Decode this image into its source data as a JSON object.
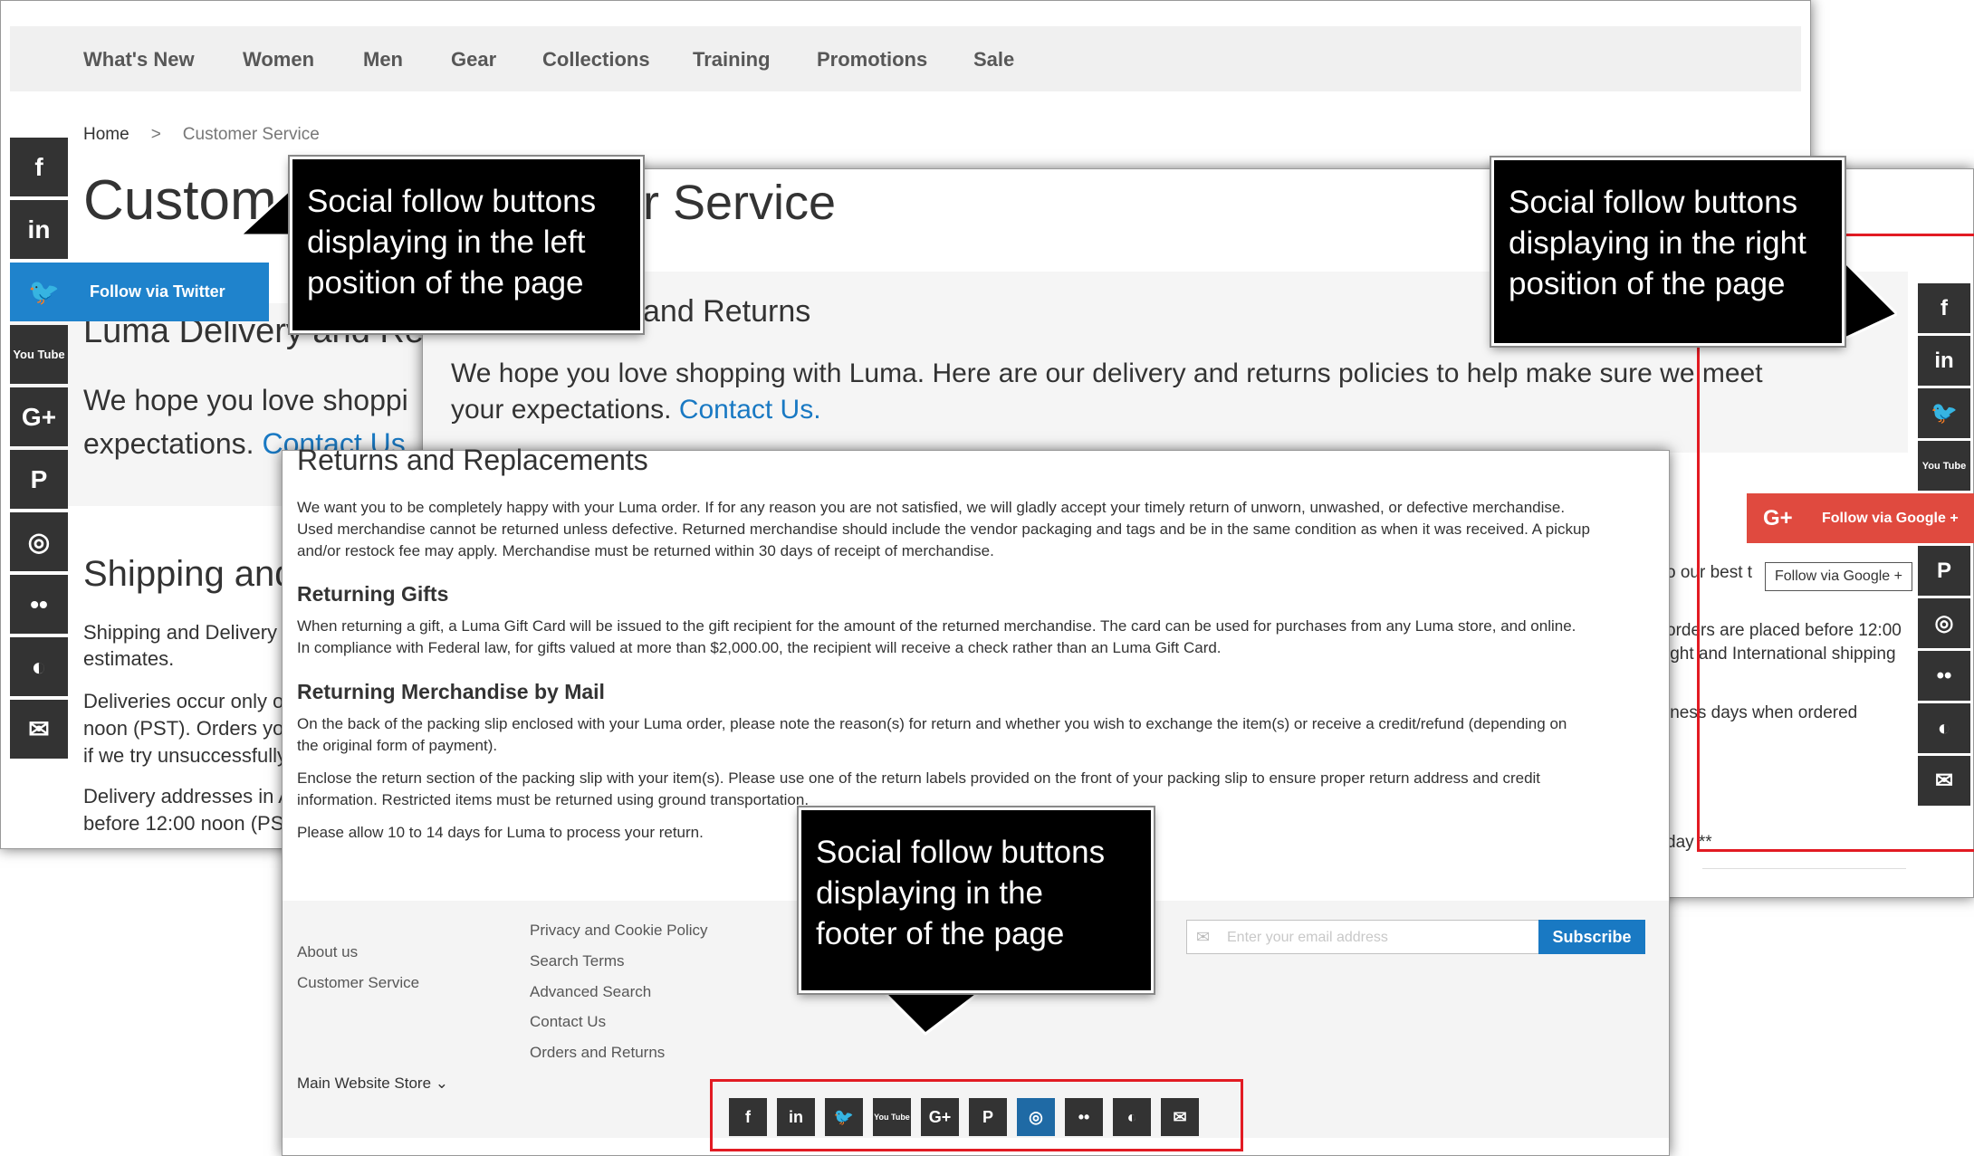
{
  "back_page": {
    "nav": [
      "What's New",
      "Women",
      "Men",
      "Gear",
      "Collections",
      "Training",
      "Promotions",
      "Sale"
    ],
    "breadcrumb": {
      "home": "Home",
      "separator": ">",
      "current": "Customer Service"
    },
    "title": "Custom",
    "section_heading": "Luma Delivery and Re",
    "intro_line1": "We hope you love shoppi",
    "intro_line2": "expectations.",
    "intro_link": "Contact Us",
    "shipping_heading": "Shipping and",
    "texts": [
      "Shipping and Delivery",
      "estimates.",
      "Deliveries occur only o",
      "noon (PST). Orders yo",
      "if we try unsuccessfully",
      "Delivery addresses in A",
      "before 12:00 noon (PS"
    ],
    "left_social": {
      "follow_label": "Follow via Twitter",
      "buttons": [
        {
          "icon": "facebook-icon",
          "glyph": "f"
        },
        {
          "icon": "linkedin-icon",
          "glyph": "in"
        },
        {
          "icon": "twitter-icon",
          "glyph": "🐦"
        },
        {
          "icon": "youtube-icon",
          "glyph": "You Tube"
        },
        {
          "icon": "google-plus-icon",
          "glyph": "G+"
        },
        {
          "icon": "pinterest-icon",
          "glyph": "P"
        },
        {
          "icon": "instagram-icon",
          "glyph": "◎"
        },
        {
          "icon": "flickr-icon",
          "glyph": "••"
        },
        {
          "icon": "website-icon",
          "glyph": "◐"
        },
        {
          "icon": "email-icon",
          "glyph": "✉"
        }
      ]
    }
  },
  "mid_page": {
    "title": "r Service",
    "section_heading": "and Returns",
    "intro_text": "We hope you love shopping with Luma. Here are our delivery and returns policies to help make sure we meet your expectations.",
    "intro_link": "Contact Us.",
    "texts": [
      "o our best t",
      "orders are placed before 12:00",
      "ight and International shipping",
      "iness days when ordered",
      "day **"
    ],
    "right_social": {
      "follow_label": "Follow via Google +",
      "tooltip": "Follow via Google +",
      "buttons": [
        {
          "icon": "facebook-icon",
          "glyph": "f"
        },
        {
          "icon": "linkedin-icon",
          "glyph": "in"
        },
        {
          "icon": "twitter-icon",
          "glyph": "🐦"
        },
        {
          "icon": "youtube-icon",
          "glyph": "You Tube"
        },
        {
          "icon": "google-plus-icon",
          "glyph": "G+"
        },
        {
          "icon": "pinterest-icon",
          "glyph": "P"
        },
        {
          "icon": "instagram-icon",
          "glyph": "◎"
        },
        {
          "icon": "flickr-icon",
          "glyph": "••"
        },
        {
          "icon": "website-icon",
          "glyph": "◐"
        },
        {
          "icon": "email-icon",
          "glyph": "✉"
        }
      ]
    }
  },
  "front_page": {
    "heading": "Returns and Replacements",
    "para1": [
      "We want you to be completely happy with your Luma order. If for any reason you are not satisfied, we will gladly accept your timely return of unworn, unwashed, or defective merchandise.",
      "Used merchandise cannot be returned unless defective. Returned merchandise should include the vendor packaging and tags and be in the same condition as when it was received. A pickup",
      "and/or restock fee may apply. Merchandise must be returned within 30 days of receipt of merchandise."
    ],
    "gifts_heading": "Returning Gifts",
    "gifts_para": [
      "When returning a gift, a Luma Gift Card will be issued to the gift recipient for the amount of the returned merchandise. The card can be used for purchases from any Luma store, and online.",
      "In compliance with Federal law, for gifts valued at more than $2,000.00, the recipient will receive a check rather than an Luma Gift Card."
    ],
    "mail_heading": "Returning Merchandise by Mail",
    "mail_para1": [
      "On the back of the packing slip enclosed with your Luma order, please note the reason(s) for return and whether you wish to exchange the item(s) or receive a credit/refund (depending on",
      "the original form of payment)."
    ],
    "mail_para2": [
      "Enclose the return section of the packing slip with your item(s). Please use one of the return labels provided on the front of your packing slip to ensure proper return address and credit",
      "information. Restricted items must be returned using ground transportation."
    ],
    "mail_para3": "Please allow 10 to 14 days for Luma to process your return.",
    "footer": {
      "col1": [
        "About us",
        "Customer Service"
      ],
      "col2": [
        "Privacy and Cookie Policy",
        "Search Terms",
        "Advanced Search",
        "Contact Us",
        "Orders and Returns"
      ],
      "store_switcher": "Main Website Store",
      "newsletter_placeholder": "Enter your email address",
      "subscribe": "Subscribe",
      "social_buttons": [
        {
          "icon": "facebook-icon",
          "glyph": "f"
        },
        {
          "icon": "linkedin-icon",
          "glyph": "in"
        },
        {
          "icon": "twitter-icon",
          "glyph": "🐦"
        },
        {
          "icon": "youtube-icon",
          "glyph": "You Tube"
        },
        {
          "icon": "google-plus-icon",
          "glyph": "G+"
        },
        {
          "icon": "pinterest-icon",
          "glyph": "P"
        },
        {
          "icon": "instagram-icon",
          "glyph": "◎"
        },
        {
          "icon": "flickr-icon",
          "glyph": "••"
        },
        {
          "icon": "website-icon",
          "glyph": "◐"
        },
        {
          "icon": "email-icon",
          "glyph": "✉"
        }
      ]
    }
  },
  "callouts": {
    "left": [
      "Social follow buttons",
      "displaying in the left",
      "position of the page"
    ],
    "right": [
      "Social follow buttons",
      "displaying in the right",
      "position of the page"
    ],
    "footer": [
      "Social follow buttons",
      "displaying in the",
      "footer of  the page"
    ]
  },
  "colors": {
    "accent": "#1979c3",
    "twitter": "#1f83cc",
    "google_plus": "#e04a3f",
    "highlight_box": "#e21b23",
    "button_bg": "#333333"
  }
}
